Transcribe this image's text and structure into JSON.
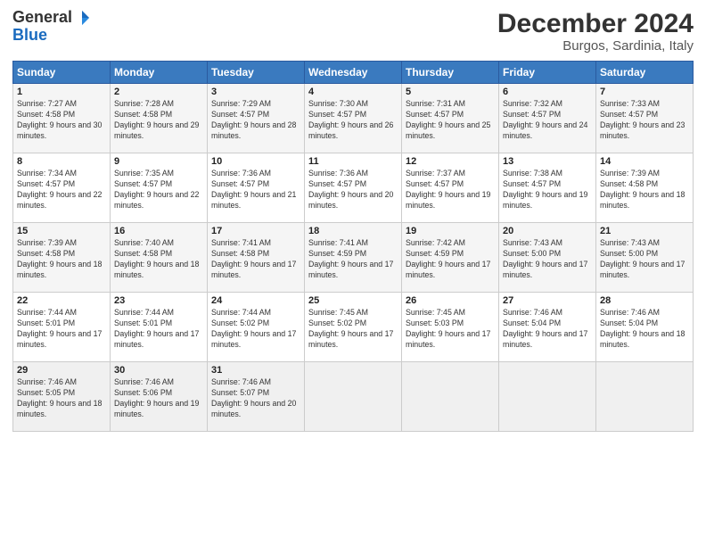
{
  "logo": {
    "general": "General",
    "blue": "Blue"
  },
  "title": "December 2024",
  "location": "Burgos, Sardinia, Italy",
  "headers": [
    "Sunday",
    "Monday",
    "Tuesday",
    "Wednesday",
    "Thursday",
    "Friday",
    "Saturday"
  ],
  "weeks": [
    [
      {
        "day": "1",
        "sunrise": "Sunrise: 7:27 AM",
        "sunset": "Sunset: 4:58 PM",
        "daylight": "Daylight: 9 hours and 30 minutes."
      },
      {
        "day": "2",
        "sunrise": "Sunrise: 7:28 AM",
        "sunset": "Sunset: 4:58 PM",
        "daylight": "Daylight: 9 hours and 29 minutes."
      },
      {
        "day": "3",
        "sunrise": "Sunrise: 7:29 AM",
        "sunset": "Sunset: 4:57 PM",
        "daylight": "Daylight: 9 hours and 28 minutes."
      },
      {
        "day": "4",
        "sunrise": "Sunrise: 7:30 AM",
        "sunset": "Sunset: 4:57 PM",
        "daylight": "Daylight: 9 hours and 26 minutes."
      },
      {
        "day": "5",
        "sunrise": "Sunrise: 7:31 AM",
        "sunset": "Sunset: 4:57 PM",
        "daylight": "Daylight: 9 hours and 25 minutes."
      },
      {
        "day": "6",
        "sunrise": "Sunrise: 7:32 AM",
        "sunset": "Sunset: 4:57 PM",
        "daylight": "Daylight: 9 hours and 24 minutes."
      },
      {
        "day": "7",
        "sunrise": "Sunrise: 7:33 AM",
        "sunset": "Sunset: 4:57 PM",
        "daylight": "Daylight: 9 hours and 23 minutes."
      }
    ],
    [
      {
        "day": "8",
        "sunrise": "Sunrise: 7:34 AM",
        "sunset": "Sunset: 4:57 PM",
        "daylight": "Daylight: 9 hours and 22 minutes."
      },
      {
        "day": "9",
        "sunrise": "Sunrise: 7:35 AM",
        "sunset": "Sunset: 4:57 PM",
        "daylight": "Daylight: 9 hours and 22 minutes."
      },
      {
        "day": "10",
        "sunrise": "Sunrise: 7:36 AM",
        "sunset": "Sunset: 4:57 PM",
        "daylight": "Daylight: 9 hours and 21 minutes."
      },
      {
        "day": "11",
        "sunrise": "Sunrise: 7:36 AM",
        "sunset": "Sunset: 4:57 PM",
        "daylight": "Daylight: 9 hours and 20 minutes."
      },
      {
        "day": "12",
        "sunrise": "Sunrise: 7:37 AM",
        "sunset": "Sunset: 4:57 PM",
        "daylight": "Daylight: 9 hours and 19 minutes."
      },
      {
        "day": "13",
        "sunrise": "Sunrise: 7:38 AM",
        "sunset": "Sunset: 4:57 PM",
        "daylight": "Daylight: 9 hours and 19 minutes."
      },
      {
        "day": "14",
        "sunrise": "Sunrise: 7:39 AM",
        "sunset": "Sunset: 4:58 PM",
        "daylight": "Daylight: 9 hours and 18 minutes."
      }
    ],
    [
      {
        "day": "15",
        "sunrise": "Sunrise: 7:39 AM",
        "sunset": "Sunset: 4:58 PM",
        "daylight": "Daylight: 9 hours and 18 minutes."
      },
      {
        "day": "16",
        "sunrise": "Sunrise: 7:40 AM",
        "sunset": "Sunset: 4:58 PM",
        "daylight": "Daylight: 9 hours and 18 minutes."
      },
      {
        "day": "17",
        "sunrise": "Sunrise: 7:41 AM",
        "sunset": "Sunset: 4:58 PM",
        "daylight": "Daylight: 9 hours and 17 minutes."
      },
      {
        "day": "18",
        "sunrise": "Sunrise: 7:41 AM",
        "sunset": "Sunset: 4:59 PM",
        "daylight": "Daylight: 9 hours and 17 minutes."
      },
      {
        "day": "19",
        "sunrise": "Sunrise: 7:42 AM",
        "sunset": "Sunset: 4:59 PM",
        "daylight": "Daylight: 9 hours and 17 minutes."
      },
      {
        "day": "20",
        "sunrise": "Sunrise: 7:43 AM",
        "sunset": "Sunset: 5:00 PM",
        "daylight": "Daylight: 9 hours and 17 minutes."
      },
      {
        "day": "21",
        "sunrise": "Sunrise: 7:43 AM",
        "sunset": "Sunset: 5:00 PM",
        "daylight": "Daylight: 9 hours and 17 minutes."
      }
    ],
    [
      {
        "day": "22",
        "sunrise": "Sunrise: 7:44 AM",
        "sunset": "Sunset: 5:01 PM",
        "daylight": "Daylight: 9 hours and 17 minutes."
      },
      {
        "day": "23",
        "sunrise": "Sunrise: 7:44 AM",
        "sunset": "Sunset: 5:01 PM",
        "daylight": "Daylight: 9 hours and 17 minutes."
      },
      {
        "day": "24",
        "sunrise": "Sunrise: 7:44 AM",
        "sunset": "Sunset: 5:02 PM",
        "daylight": "Daylight: 9 hours and 17 minutes."
      },
      {
        "day": "25",
        "sunrise": "Sunrise: 7:45 AM",
        "sunset": "Sunset: 5:02 PM",
        "daylight": "Daylight: 9 hours and 17 minutes."
      },
      {
        "day": "26",
        "sunrise": "Sunrise: 7:45 AM",
        "sunset": "Sunset: 5:03 PM",
        "daylight": "Daylight: 9 hours and 17 minutes."
      },
      {
        "day": "27",
        "sunrise": "Sunrise: 7:46 AM",
        "sunset": "Sunset: 5:04 PM",
        "daylight": "Daylight: 9 hours and 17 minutes."
      },
      {
        "day": "28",
        "sunrise": "Sunrise: 7:46 AM",
        "sunset": "Sunset: 5:04 PM",
        "daylight": "Daylight: 9 hours and 18 minutes."
      }
    ],
    [
      {
        "day": "29",
        "sunrise": "Sunrise: 7:46 AM",
        "sunset": "Sunset: 5:05 PM",
        "daylight": "Daylight: 9 hours and 18 minutes."
      },
      {
        "day": "30",
        "sunrise": "Sunrise: 7:46 AM",
        "sunset": "Sunset: 5:06 PM",
        "daylight": "Daylight: 9 hours and 19 minutes."
      },
      {
        "day": "31",
        "sunrise": "Sunrise: 7:46 AM",
        "sunset": "Sunset: 5:07 PM",
        "daylight": "Daylight: 9 hours and 20 minutes."
      },
      null,
      null,
      null,
      null
    ]
  ]
}
